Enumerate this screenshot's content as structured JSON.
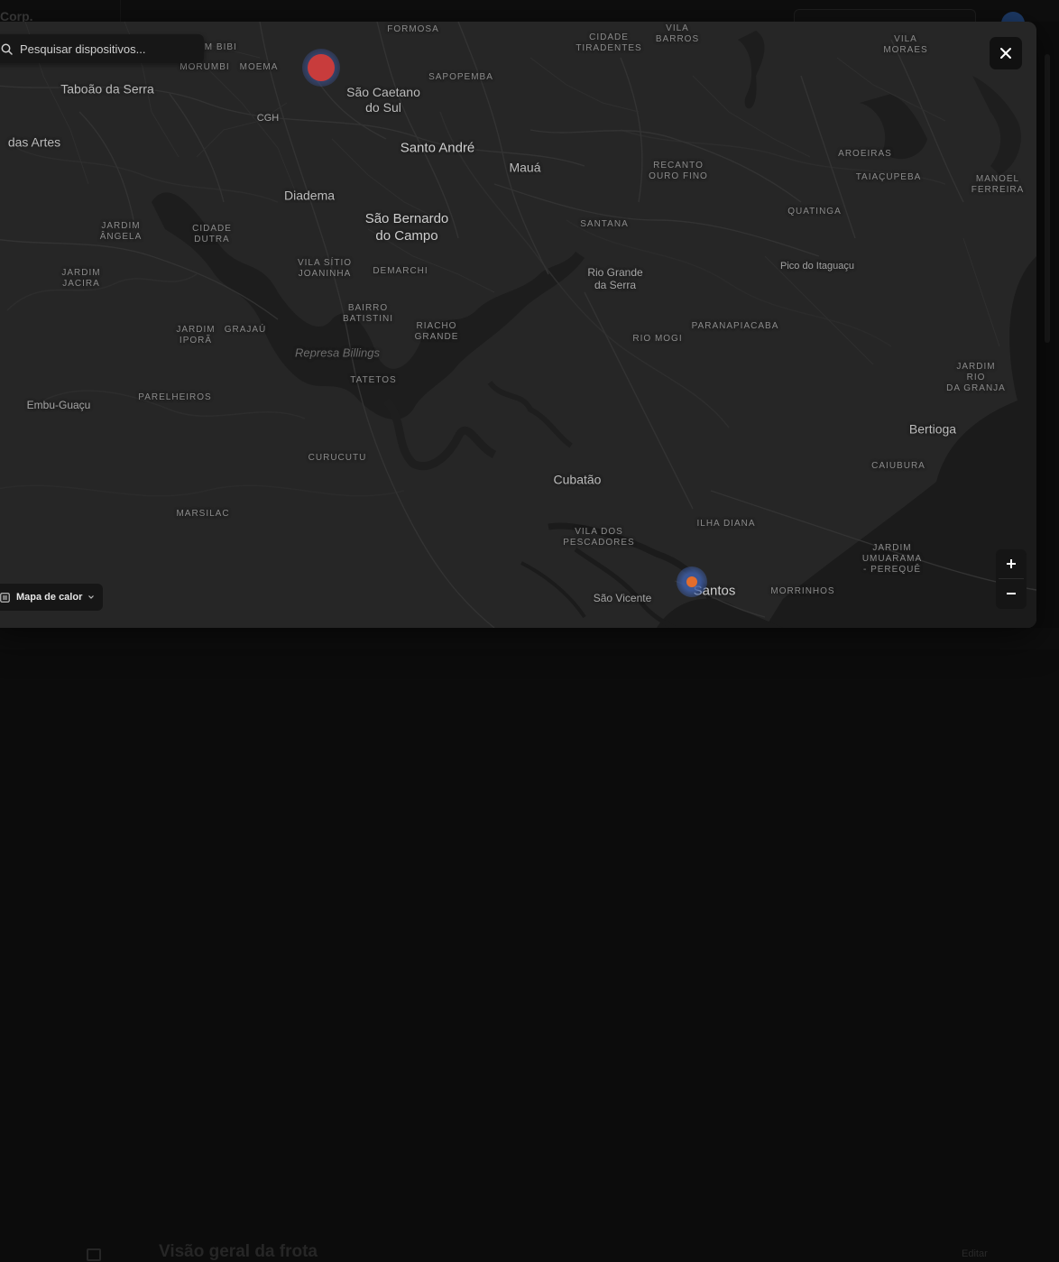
{
  "background": {
    "brand_fragment": "Corp.",
    "page_heading": "Visão geral da frota",
    "right_fragment": "Editar"
  },
  "search": {
    "placeholder": "Pesquisar dispositivos...",
    "icon": "search-icon"
  },
  "close_icon": "close-icon",
  "zoom": {
    "in_icon": "plus-icon",
    "out_icon": "minus-icon"
  },
  "layer_selector": {
    "label": "Mapa de calor",
    "icon": "layers-icon",
    "chevron": "chevron-down-icon"
  },
  "map": {
    "labels": [
      {
        "text": "Taboão da Serra",
        "kind": "city"
      },
      {
        "text": "das Artes",
        "kind": "city"
      },
      {
        "text": "ITAIM BIBI",
        "kind": "nb"
      },
      {
        "text": "MORUMBI",
        "kind": "nb"
      },
      {
        "text": "MOEMA",
        "kind": "nb"
      },
      {
        "text": "FORMOSA",
        "kind": "nb"
      },
      {
        "text": "CGH",
        "kind": "poi"
      },
      {
        "text": "São Caetano\ndo Sul",
        "kind": "city"
      },
      {
        "text": "SAPOPEMBA",
        "kind": "nb"
      },
      {
        "text": "Santo André",
        "kind": "major"
      },
      {
        "text": "Mauá",
        "kind": "city"
      },
      {
        "text": "Diadema",
        "kind": "city"
      },
      {
        "text": "São Bernardo\ndo Campo",
        "kind": "major"
      },
      {
        "text": "CIDADE\nTIRADENTES",
        "kind": "nb"
      },
      {
        "text": "VILA\nBARROS",
        "kind": "nb"
      },
      {
        "text": "VILA\nMORAES",
        "kind": "nb"
      },
      {
        "text": "RECANTO\nOURO FINO",
        "kind": "nb"
      },
      {
        "text": "AROEIRAS",
        "kind": "nb"
      },
      {
        "text": "TAIAÇUPEBA",
        "kind": "nb"
      },
      {
        "text": "MANOEL\nFERREIRA",
        "kind": "nb"
      },
      {
        "text": "QUATINGA",
        "kind": "nb"
      },
      {
        "text": "SANTANA",
        "kind": "nb"
      },
      {
        "text": "JARDIM\nÂNGELA",
        "kind": "nb"
      },
      {
        "text": "CIDADE\nDUTRA",
        "kind": "nb"
      },
      {
        "text": "JARDIM\nJACIRA",
        "kind": "nb"
      },
      {
        "text": "VILA SÍTIO\nJOANINHA",
        "kind": "nb"
      },
      {
        "text": "DEMARCHI",
        "kind": "nb"
      },
      {
        "text": "Rio Grande\nda Serra",
        "kind": "minor"
      },
      {
        "text": "Pico do Itaguaçu",
        "kind": "poi"
      },
      {
        "text": "BAIRRO\nBATISTINI",
        "kind": "nb"
      },
      {
        "text": "JARDIM\nIPORÃ",
        "kind": "nb"
      },
      {
        "text": "GRAJAÚ",
        "kind": "nb"
      },
      {
        "text": "RIACHO\nGRANDE",
        "kind": "nb"
      },
      {
        "text": "PARANAPIACABA",
        "kind": "nb"
      },
      {
        "text": "RIO MOGI",
        "kind": "nb"
      },
      {
        "text": "Represa Billings",
        "kind": "water"
      },
      {
        "text": "JARDIM RIO\nDA GRANJA",
        "kind": "nb"
      },
      {
        "text": "TATETOS",
        "kind": "nb"
      },
      {
        "text": "Embu-Guaçu",
        "kind": "minor"
      },
      {
        "text": "PARELHEIROS",
        "kind": "nb"
      },
      {
        "text": "Bertioga",
        "kind": "city"
      },
      {
        "text": "CURUCUTU",
        "kind": "nb"
      },
      {
        "text": "CAIUBURA",
        "kind": "nb"
      },
      {
        "text": "Cubatão",
        "kind": "city"
      },
      {
        "text": "MARSILAC",
        "kind": "nb"
      },
      {
        "text": "ILHA DIANA",
        "kind": "nb"
      },
      {
        "text": "VILA DOS\nPESCADORES",
        "kind": "nb"
      },
      {
        "text": "JARDIM\nUMUARAMA\n- PEREQUÊ",
        "kind": "nb"
      },
      {
        "text": "São Vicente",
        "kind": "minor"
      },
      {
        "text": "Santos",
        "kind": "major"
      },
      {
        "text": "MORRINHOS",
        "kind": "nb"
      }
    ],
    "markers": [
      {
        "name": "heat-marker-sao-caetano",
        "ring_color": "#3a4e86",
        "dot_color": "#c83c3c"
      },
      {
        "name": "heat-marker-santos",
        "ring_color": "#3f5fa8",
        "dot_color": "#e36d2d"
      }
    ],
    "colors": {
      "land": "#262626",
      "water": "#1b1b1b",
      "roads": "#333333"
    }
  }
}
